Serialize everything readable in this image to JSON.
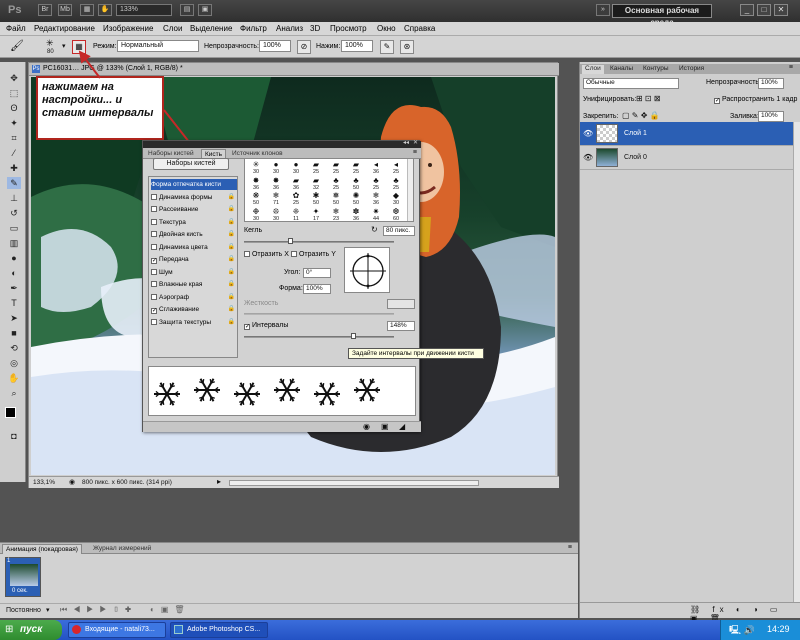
{
  "app": {
    "logo": "Ps",
    "zoom": "133%",
    "workspace": "Основная рабочая среда"
  },
  "menu": [
    "Файл",
    "Редактирование",
    "Изображение",
    "Слои",
    "Выделение",
    "Фильтр",
    "Анализ",
    "3D",
    "Просмотр",
    "Окно",
    "Справка"
  ],
  "options": {
    "brush_size": "80",
    "mode_label": "Режим:",
    "mode_value": "Нормальный",
    "opacity_label": "Непрозрачность:",
    "opacity_value": "100%",
    "flow_label": "Нажим:",
    "flow_value": "100%"
  },
  "document": {
    "title": "PC16031… JPG @ 133% (Слой 1, RGB/8) *",
    "zoom_status": "133,1%",
    "size_status": "800 пикс. x 600 пикс. (314 ppi)"
  },
  "annotation": "нажимаем на настройки... и ставим интервалы",
  "brush_panel": {
    "tabs": [
      "Наборы кистей",
      "Кисть",
      "Источник клонов"
    ],
    "preset_button": "Наборы кистей",
    "options": [
      {
        "label": "Форма отпечатка кисти",
        "checked": false,
        "selected": true,
        "lock": false
      },
      {
        "label": "Динамика формы",
        "checked": false,
        "selected": false,
        "lock": true
      },
      {
        "label": "Рассеивание",
        "checked": false,
        "selected": false,
        "lock": true
      },
      {
        "label": "Текстура",
        "checked": false,
        "selected": false,
        "lock": true
      },
      {
        "label": "Двойная кисть",
        "checked": false,
        "selected": false,
        "lock": true
      },
      {
        "label": "Динамика цвета",
        "checked": false,
        "selected": false,
        "lock": true
      },
      {
        "label": "Передача",
        "checked": true,
        "selected": false,
        "lock": true
      },
      {
        "label": "Шум",
        "checked": false,
        "selected": false,
        "lock": true
      },
      {
        "label": "Влажные края",
        "checked": false,
        "selected": false,
        "lock": true
      },
      {
        "label": "Аэрограф",
        "checked": false,
        "selected": false,
        "lock": true
      },
      {
        "label": "Сглаживание",
        "checked": true,
        "selected": false,
        "lock": true
      },
      {
        "label": "Защита текстуры",
        "checked": false,
        "selected": false,
        "lock": true
      }
    ],
    "tips": [
      {
        "glyph": "✳",
        "size": "30"
      },
      {
        "glyph": "●",
        "size": "30"
      },
      {
        "glyph": "●",
        "size": "30"
      },
      {
        "glyph": "▰",
        "size": "25"
      },
      {
        "glyph": "▰",
        "size": "25"
      },
      {
        "glyph": "▰",
        "size": "25"
      },
      {
        "glyph": "◂",
        "size": "36"
      },
      {
        "glyph": "◂",
        "size": "25"
      },
      {
        "glyph": "✸",
        "size": "36"
      },
      {
        "glyph": "✸",
        "size": "36"
      },
      {
        "glyph": "▰",
        "size": "36"
      },
      {
        "glyph": "▰",
        "size": "32"
      },
      {
        "glyph": "♣",
        "size": "25"
      },
      {
        "glyph": "♣",
        "size": "50"
      },
      {
        "glyph": "♣",
        "size": "25"
      },
      {
        "glyph": "♣",
        "size": "25"
      },
      {
        "glyph": "❋",
        "size": "50"
      },
      {
        "glyph": "❄",
        "size": "71"
      },
      {
        "glyph": "✿",
        "size": "25"
      },
      {
        "glyph": "✱",
        "size": "50"
      },
      {
        "glyph": "❅",
        "size": "50"
      },
      {
        "glyph": "✺",
        "size": "50"
      },
      {
        "glyph": "❄",
        "size": "36"
      },
      {
        "glyph": "◆",
        "size": "30"
      },
      {
        "glyph": "❉",
        "size": "30"
      },
      {
        "glyph": "❊",
        "size": "30"
      },
      {
        "glyph": "❈",
        "size": "11"
      },
      {
        "glyph": "✦",
        "size": "17"
      },
      {
        "glyph": "❄",
        "size": "23"
      },
      {
        "glyph": "✽",
        "size": "36"
      },
      {
        "glyph": "✷",
        "size": "44"
      },
      {
        "glyph": "❆",
        "size": "60"
      }
    ],
    "size_label": "Кегль",
    "size_value": "80 пикс.",
    "flip_x": "Отразить X",
    "flip_y": "Отразить Y",
    "angle_label": "Угол:",
    "angle_value": "0°",
    "roundness_label": "Форма:",
    "roundness_value": "100%",
    "hardness_label": "Жесткость",
    "spacing_label": "Интервалы",
    "spacing_value": "148%",
    "spacing_fraction": 0.74,
    "size_fraction": 0.3,
    "tooltip": "Задайте интервалы при движении кисти"
  },
  "layers_panel": {
    "tabs": [
      "Слои",
      "Каналы",
      "Контуры",
      "История"
    ],
    "blend_mode": "Обычные",
    "opacity_label": "Непрозрачность:",
    "opacity_value": "100%",
    "unify_label": "Унифицировать:",
    "propagate_label": "Распространить 1 кадр",
    "lock_label": "Закрепить:",
    "fill_label": "Заливка:",
    "fill_value": "100%",
    "layers": [
      {
        "name": "Слой 1",
        "selected": true
      },
      {
        "name": "Слой 0",
        "selected": false
      }
    ]
  },
  "animation_panel": {
    "tabs": [
      "Анимация (покадровая)",
      "Журнал измерений"
    ],
    "frame_time": "0 сек.",
    "frame_number": "1",
    "loop": "Постоянно"
  },
  "taskbar": {
    "start": "пуск",
    "tasks": [
      "Входящие - natali73...",
      "Adobe Photoshop CS..."
    ],
    "lang": "RU",
    "clock": "14:29"
  },
  "colors": {
    "accent": "#2b5fb4",
    "annotation_border": "#b0251d",
    "arrow": "#c62828"
  }
}
